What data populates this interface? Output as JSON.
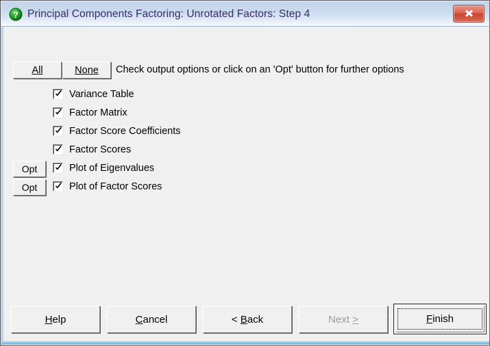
{
  "window": {
    "title": "Principal Components Factoring: Unrotated Factors: Step 4",
    "icon": "question-mark-icon",
    "icon_color": "#1f9b24",
    "title_color": "#3b2a64",
    "close_label": "x",
    "close_color": "#c8462f",
    "background_color": "#f0f0f0",
    "titlebar_color": "#cfdcef"
  },
  "toolbar": {
    "all_label": "All",
    "all_accel": "A",
    "none_label": "None",
    "none_accel": "N",
    "instruction": "Check output options or click on an 'Opt' button for further options"
  },
  "options": {
    "opt_button_label": "Opt",
    "items": [
      {
        "label": "Variance Table",
        "checked": true,
        "has_opt": false
      },
      {
        "label": "Factor Matrix",
        "checked": true,
        "has_opt": false
      },
      {
        "label": "Factor Score Coefficients",
        "checked": true,
        "has_opt": false
      },
      {
        "label": "Factor Scores",
        "checked": true,
        "has_opt": false
      },
      {
        "label": "Plot of Eigenvalues",
        "checked": true,
        "has_opt": true
      },
      {
        "label": "Plot of Factor Scores",
        "checked": true,
        "has_opt": true
      }
    ]
  },
  "footer": {
    "help": {
      "pre": "",
      "accel": "H",
      "post": "elp",
      "disabled": false
    },
    "cancel": {
      "pre": "",
      "accel": "C",
      "post": "ancel",
      "disabled": false
    },
    "back": {
      "pre": "< ",
      "accel": "B",
      "post": "ack",
      "disabled": false
    },
    "next": {
      "pre": "Next ",
      "accel": ">",
      "post": "",
      "disabled": true
    },
    "finish": {
      "pre": "",
      "accel": "F",
      "post": "inish",
      "disabled": false,
      "default": true
    }
  }
}
